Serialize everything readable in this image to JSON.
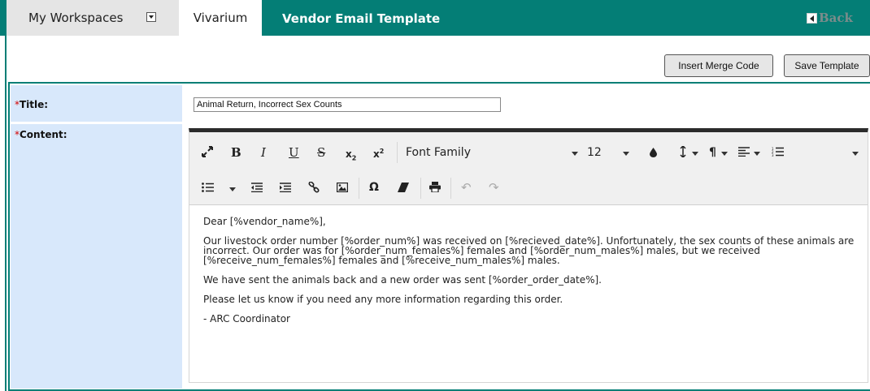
{
  "tabs": {
    "workspaces": "My Workspaces",
    "vivarium": "Vivarium",
    "title": "Vendor Email Template",
    "back": "Back"
  },
  "actions": {
    "insert_merge": "Insert Merge Code",
    "save_template": "Save Template"
  },
  "form": {
    "title_label": "Title:",
    "content_label": "Content:",
    "required_mark": "*",
    "title_value": "Animal Return, Incorrect Sex Counts"
  },
  "toolbar": {
    "font_family": "Font Family",
    "font_size": "12",
    "row1_icons": [
      "fullscreen-icon",
      "bold-icon",
      "italic-icon",
      "underline-icon",
      "strikethrough-icon",
      "subscript-icon",
      "superscript-icon",
      "font-family-dropdown",
      "font-size-dropdown",
      "color-icon",
      "line-height-icon",
      "paragraph-format-icon",
      "align-icon",
      "ordered-list-icon"
    ],
    "row2_icons": [
      "unordered-list-icon",
      "outdent-icon",
      "indent-icon",
      "link-icon",
      "image-icon",
      "special-chars-icon",
      "clear-format-icon",
      "print-icon",
      "undo-icon",
      "redo-icon"
    ]
  },
  "content": {
    "p1": "Dear [%vendor_name%],",
    "p2": "Our livestock order number [%order_num%] was received on [%recieved_date%]. Unfortunately, the sex counts of these animals are incorrect. Our order was for [%order_num_females%] females and [%order_num_males%] males, but we received [%receive_num_females%] females and [%receive_num_males%] males.",
    "p3": "We have sent the animals back and a new order was sent [%order_order_date%].",
    "p4": "Please let us know if you need any more information regarding this order.",
    "p5": "- ARC Coordinator"
  },
  "colors": {
    "brand_teal": "#047e76",
    "label_bg": "#d8e8fb",
    "required_red": "#d40000"
  }
}
